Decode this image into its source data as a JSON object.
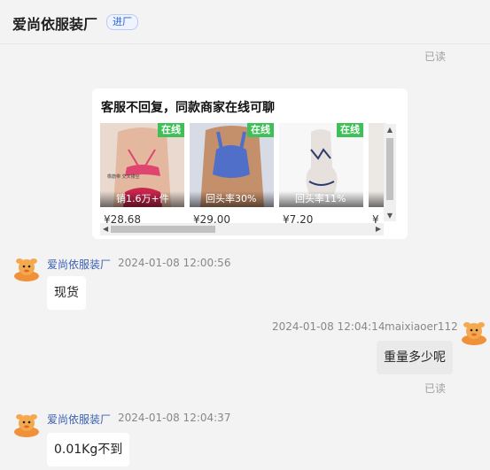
{
  "header": {
    "shop_name": "爱尚依服装厂",
    "enter_label": "进厂"
  },
  "read_label": "已读",
  "recommend_card": {
    "title": "客服不回复，同款商家在线可聊",
    "online_label": "在线",
    "products": [
      {
        "stat": "销1.6万+件",
        "price": "¥28.68",
        "image_caption": "橡筋带 交叉镂空"
      },
      {
        "stat": "回头率30%",
        "price": "¥29.00"
      },
      {
        "stat": "回头率11%",
        "price": "¥7.20"
      },
      {
        "stat": "",
        "price": "¥"
      }
    ]
  },
  "messages": [
    {
      "sender": "爱尚依服装厂",
      "time": "2024-01-08 12:00:56",
      "text": "现货"
    },
    {
      "sender": "maixiaoer112",
      "time": "2024-01-08 12:04:14",
      "text": "重量多少呢",
      "status": "已读"
    },
    {
      "sender": "爱尚依服装厂",
      "time": "2024-01-08 12:04:37",
      "text": "0.01Kg不到"
    }
  ],
  "colors": {
    "online_badge": "#3fbf57",
    "sender_name": "#3a5fb0",
    "enter_button": "#2a62d6"
  },
  "icons": {
    "avatar": "cartoon-mascot-avatar-icon"
  }
}
